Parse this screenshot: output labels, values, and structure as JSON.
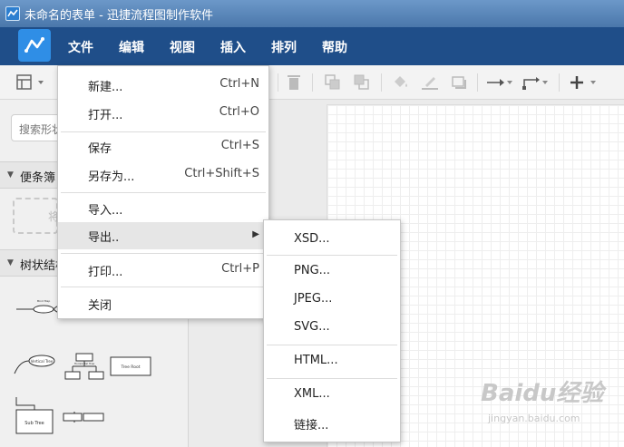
{
  "window": {
    "title": "未命名的表单 - 迅捷流程图制作软件"
  },
  "menubar": {
    "items": [
      "文件",
      "编辑",
      "视图",
      "插入",
      "排列",
      "帮助"
    ]
  },
  "sidebar": {
    "search_placeholder": "搜索形状",
    "sections": [
      "便条簿",
      "树状结构"
    ],
    "drop_hint": "将",
    "shapes": [
      "Vertical Tree",
      "Horizontal Tree",
      "Tree Root",
      "Sub Tree",
      "Mind Map"
    ]
  },
  "file_menu": {
    "items": [
      {
        "label": "新建...",
        "shortcut": "Ctrl+N"
      },
      {
        "label": "打开...",
        "shortcut": "Ctrl+O"
      },
      {
        "label": "保存",
        "shortcut": "Ctrl+S"
      },
      {
        "label": "另存为...",
        "shortcut": "Ctrl+Shift+S"
      },
      {
        "label": "导入...",
        "shortcut": ""
      },
      {
        "label": "导出..",
        "shortcut": ""
      },
      {
        "label": "打印...",
        "shortcut": "Ctrl+P"
      },
      {
        "label": "关闭",
        "shortcut": ""
      }
    ]
  },
  "export_menu": {
    "items": [
      "XSD...",
      "PNG...",
      "JPEG...",
      "SVG...",
      "HTML...",
      "XML...",
      "链接..."
    ]
  },
  "watermark": {
    "brand": "Baidu经验",
    "url": "jingyan.baidu.com"
  },
  "colors": {
    "menubar": "#1f4e89",
    "accent": "#2f8ee6",
    "hover": "#e6e6e6"
  }
}
